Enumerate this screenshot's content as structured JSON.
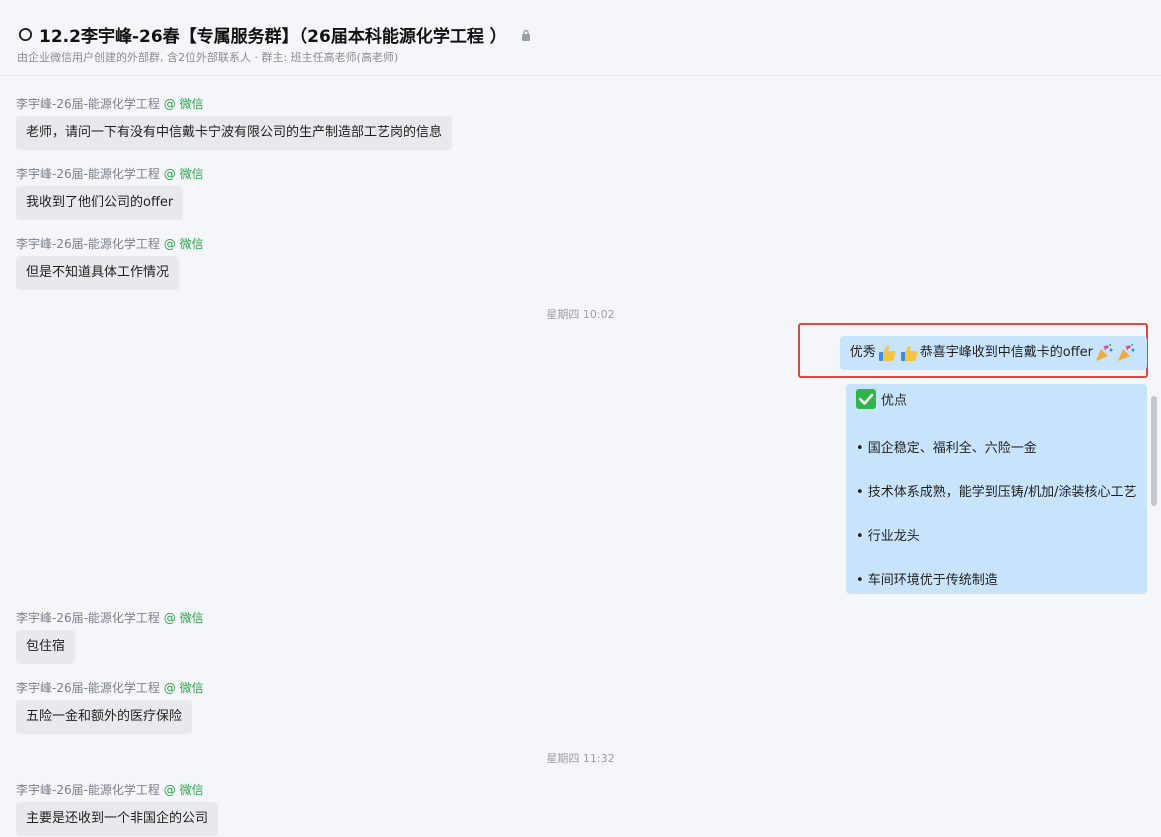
{
  "header": {
    "title": "12.2李宇峰-26春【专属服务群】（26届本科能源化学工程 ）",
    "subtitle": "由企业微信用户创建的外部群, 含2位外部联系人 · 群主: 班主任高老师(高老师)"
  },
  "messages": [
    {
      "sender": "李宇峰-26届-能源化学工程",
      "source": "@ 微信",
      "text": "老师，请问一下有没有中信戴卡宁波有限公司的生产制造部工艺岗的信息"
    },
    {
      "sender": "李宇峰-26届-能源化学工程",
      "source": "@ 微信",
      "text": "我收到了他们公司的offer"
    },
    {
      "sender": "李宇峰-26届-能源化学工程",
      "source": "@ 微信",
      "text": "但是不知道具体工作情况"
    },
    {
      "sender": "李宇峰-26届-能源化学工程",
      "source": "@ 微信",
      "text": "包住宿"
    },
    {
      "sender": "李宇峰-26届-能源化学工程",
      "source": "@ 微信",
      "text": "五险一金和额外的医疗保险"
    },
    {
      "sender": "李宇峰-26届-能源化学工程",
      "source": "@ 微信",
      "text": "主要是还收到一个非国企的公司"
    }
  ],
  "timestamps": [
    "星期四 10:02",
    "星期四 11:32"
  ],
  "outgoing": {
    "congrats": {
      "prefix": "优秀",
      "middle": "恭喜宇峰收到中信戴卡的offer",
      "emoji_before": "thumbs-up-icon",
      "emoji_after": "party-popper-icon"
    },
    "list": {
      "heading": "优点",
      "items": [
        "• 国企稳定、福利全、六险一金",
        "• 技术体系成熟，能学到压铸/机加/涂装核心工艺",
        "• 行业龙头",
        "• 车间环境优于传统制造"
      ]
    }
  },
  "colors": {
    "background": "#f5f6f9",
    "incoming_bubble": "#e8e9ec",
    "outgoing_bubble": "#c8e4fd",
    "wechat_source": "#2fa34a",
    "highlight": "#e0453f"
  }
}
